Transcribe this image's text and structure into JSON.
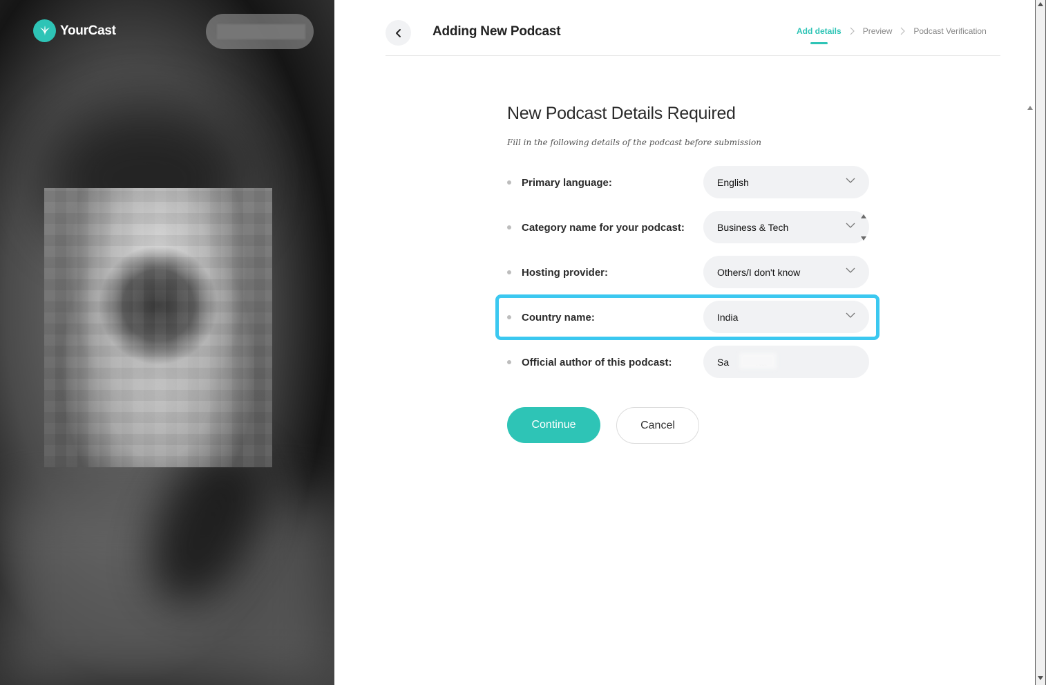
{
  "brand": {
    "name": "YourCast",
    "accent": "#2ec4b6"
  },
  "header": {
    "title": "Adding New Podcast",
    "steps": [
      {
        "label": "Add details",
        "active": true
      },
      {
        "label": "Preview",
        "active": false
      },
      {
        "label": "Podcast Verification",
        "active": false
      }
    ]
  },
  "form": {
    "title": "New Podcast Details Required",
    "subtitle": "Fill in the following details of the podcast before submission",
    "fields": [
      {
        "label": "Primary language:",
        "value": "English"
      },
      {
        "label": "Category name for your podcast:",
        "value": "Business & Tech"
      },
      {
        "label": "Hosting provider:",
        "value": "Others/I don't know"
      },
      {
        "label": "Country name:",
        "value": "India"
      },
      {
        "label": "Official author of this podcast:",
        "value": "Sa          na"
      }
    ],
    "highlight_color": "#3bc8f0"
  },
  "actions": {
    "continue": "Continue",
    "cancel": "Cancel"
  }
}
